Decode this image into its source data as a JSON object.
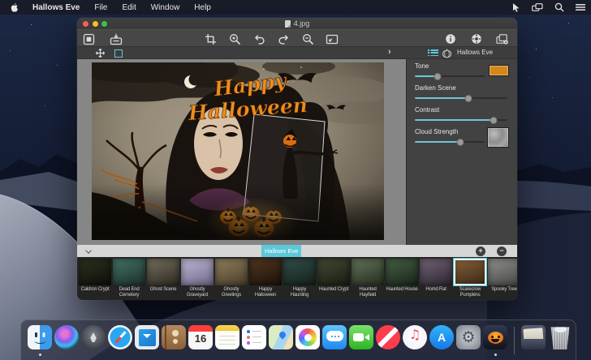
{
  "colors": {
    "accent_teal": "#5cc8da",
    "tone_swatch": "#d4881c",
    "menu_bar_bg": "#181b26",
    "panel_bg": "#424242",
    "canvas_surround": "#868686"
  },
  "menu_bar": {
    "app_menu": "Hallows Eve",
    "menus": [
      "File",
      "Edit",
      "Window",
      "Help"
    ],
    "status_icons": [
      "pointer",
      "displays",
      "spotlight",
      "notification-center"
    ]
  },
  "window": {
    "title": "4.jpg",
    "toolbar_icons_left": [
      "frame",
      "import"
    ],
    "toolbar_icons_center": [
      "crop",
      "zoom-in",
      "undo",
      "redo",
      "zoom-out",
      "fit-image"
    ],
    "toolbar_icons_right": [
      "info",
      "settings",
      "batch"
    ]
  },
  "subtoolbar": {
    "tools": [
      "move",
      "marquee"
    ],
    "panel_title": "Hallows Eve"
  },
  "panel": {
    "sliders": [
      {
        "label": "Tone",
        "value_pct": 33,
        "swatch_color": "#d4881c"
      },
      {
        "label": "Darken Scene",
        "value_pct": 58
      },
      {
        "label": "Contrast",
        "value_pct": 85
      },
      {
        "label": "Cloud Strength",
        "value_pct": 65,
        "swatch": "cloud-texture"
      }
    ]
  },
  "canvas": {
    "overlay_text": [
      "Happy",
      "Halloween"
    ],
    "overlay_text_color": "#ef8c1c"
  },
  "bottom_bar": {
    "tab_label": "Hallows Eve",
    "add_label": "+",
    "remove_label": "−"
  },
  "filmstrip": {
    "selected_index": 11,
    "items": [
      {
        "name": "Caldron Crypt",
        "tint": [
          "#2a3420",
          "#100e09"
        ]
      },
      {
        "name": "Dead End Cemetery",
        "tint": [
          "#46746a",
          "#1b2f2a"
        ]
      },
      {
        "name": "Ghost Scene",
        "tint": [
          "#77705f",
          "#2e2a21"
        ]
      },
      {
        "name": "Ghostly Graveyard",
        "tint": [
          "#c0b9d6",
          "#6f6889"
        ]
      },
      {
        "name": "Ghostly Greetings",
        "tint": [
          "#927f5f",
          "#493e2b"
        ]
      },
      {
        "name": "Happy Halloween",
        "tint": [
          "#54381f",
          "#1b110a"
        ]
      },
      {
        "name": "Happy Haunting",
        "tint": [
          "#33524a",
          "#141f1b"
        ]
      },
      {
        "name": "Haunted Crypt",
        "tint": [
          "#434d35",
          "#191c12"
        ]
      },
      {
        "name": "Haunted Hayfield",
        "tint": [
          "#64745c",
          "#262e1d"
        ]
      },
      {
        "name": "Haunted House",
        "tint": [
          "#466146",
          "#1a2518"
        ]
      },
      {
        "name": "Horrid Rat",
        "tint": [
          "#746676",
          "#2d2531"
        ]
      },
      {
        "name": "Scarecrow Pumpkins",
        "tint": [
          "#87613a",
          "#382715"
        ]
      },
      {
        "name": "Spooky Tree",
        "tint": [
          "#91918f",
          "#474745"
        ]
      }
    ]
  },
  "dock": {
    "calendar_day": "16",
    "app_store_letter": "A",
    "items": [
      "finder",
      "siri",
      "launchpad",
      "safari",
      "mail",
      "contacts",
      "calendar",
      "notes",
      "reminders",
      "maps",
      "photos",
      "messages",
      "facetime",
      "news",
      "itunes",
      "app-store",
      "system-preferences",
      "hallows-eve"
    ],
    "trailing": [
      "downloads-folder",
      "trash"
    ],
    "running": [
      "finder",
      "hallows-eve"
    ]
  }
}
